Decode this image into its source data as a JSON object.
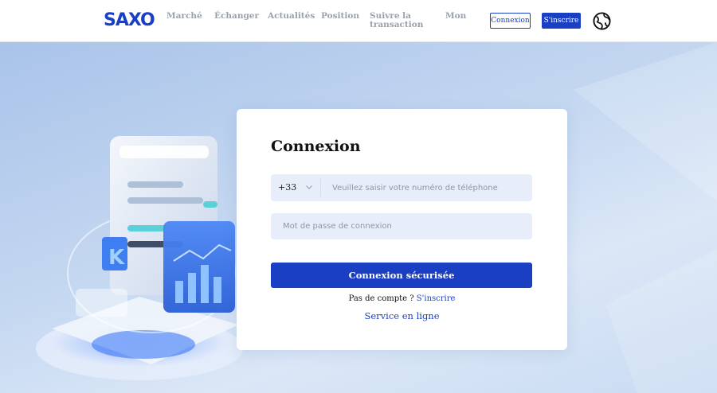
{
  "brand": {
    "logo": "SAXO",
    "color": "#1a3fc3"
  },
  "nav": {
    "items": [
      {
        "label": "Marché"
      },
      {
        "label": "Échanger"
      },
      {
        "label": "Actualités"
      },
      {
        "label": "Position"
      },
      {
        "label": "Suivre la transaction"
      },
      {
        "label": "Mon"
      }
    ],
    "login_label": "Connexion",
    "signup_label": "S'inscrire",
    "language_icon": "globe-icon"
  },
  "login": {
    "title": "Connexion",
    "country_code": "+33",
    "phone_placeholder": "Veuillez saisir votre numéro de téléphone",
    "password_placeholder": "Mot de passe de connexion",
    "submit_label": "Connexion sécurisée",
    "no_account_text": "Pas de compte ?",
    "signup_link": "S'inscrire",
    "service_link": "Service en ligne"
  }
}
